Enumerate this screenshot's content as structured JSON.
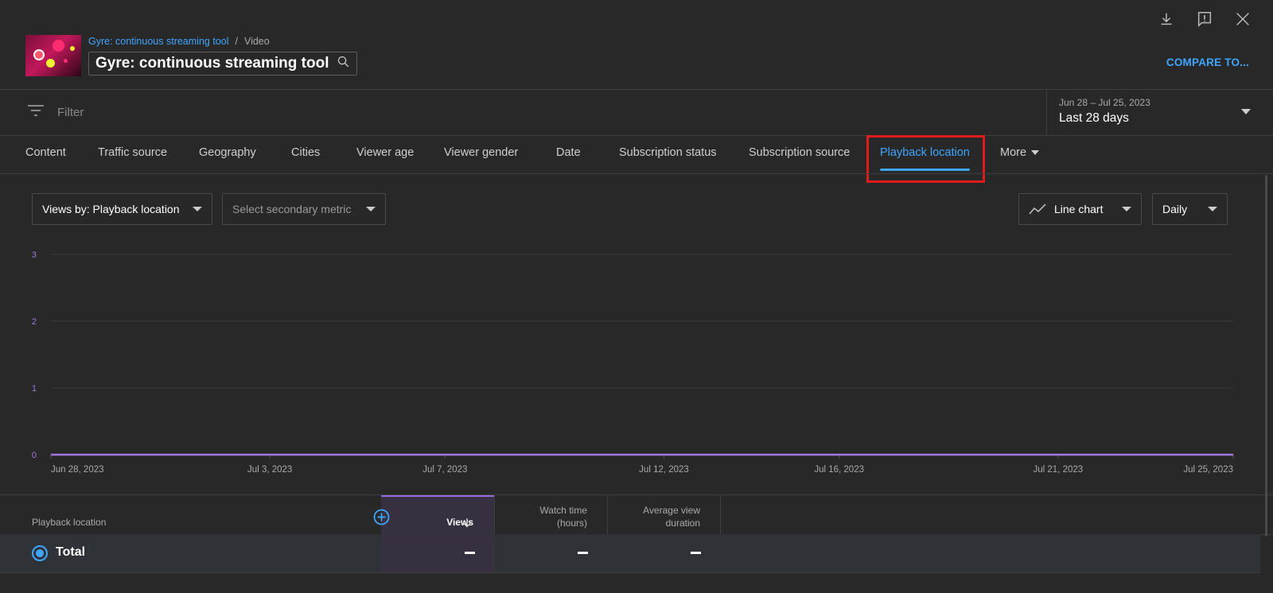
{
  "header": {
    "breadcrumb_link": "Gyre: continuous streaming tool",
    "breadcrumb_sep": "/",
    "breadcrumb_current": "Video",
    "title": "Gyre: continuous streaming tool",
    "compare_label": "COMPARE TO..."
  },
  "top_icons": [
    "download-icon",
    "feedback-icon",
    "close-icon"
  ],
  "filter": {
    "label": "Filter",
    "date_range": "Jun 28 – Jul 25, 2023",
    "period": "Last 28 days"
  },
  "tabs": [
    {
      "label": "Content"
    },
    {
      "label": "Traffic source"
    },
    {
      "label": "Geography"
    },
    {
      "label": "Cities"
    },
    {
      "label": "Viewer age"
    },
    {
      "label": "Viewer gender"
    },
    {
      "label": "Date"
    },
    {
      "label": "Subscription status"
    },
    {
      "label": "Subscription source"
    },
    {
      "label": "Playback location",
      "active": true
    },
    {
      "label": "More"
    }
  ],
  "controls": {
    "primary_metric": "Views by: Playback location",
    "secondary_metric": "Select secondary metric",
    "chart_type": "Line chart",
    "interval": "Daily"
  },
  "chart_data": {
    "type": "line",
    "ylim": [
      0,
      3
    ],
    "y_ticks": [
      "3",
      "2",
      "1",
      "0"
    ],
    "x_ticks": [
      "Jun 28, 2023",
      "Jul 3, 2023",
      "Jul 7, 2023",
      "Jul 12, 2023",
      "Jul 16, 2023",
      "Jul 21, 2023",
      "Jul 25, 2023"
    ],
    "x": [
      "Jun 28, 2023",
      "Jul 25, 2023"
    ],
    "series": [
      {
        "values": [
          0,
          0
        ]
      }
    ],
    "series_color": "#a476e0",
    "grid": true
  },
  "table": {
    "col_location": "Playback location",
    "col_views": "Views",
    "col_watch_1": "Watch time",
    "col_watch_2": "(hours)",
    "col_avd_1": "Average view",
    "col_avd_2": "duration",
    "total_label": "Total"
  },
  "colors": {
    "accent": "#3ea6ff",
    "highlight": "#e01b1b",
    "series": "#a476e0"
  }
}
